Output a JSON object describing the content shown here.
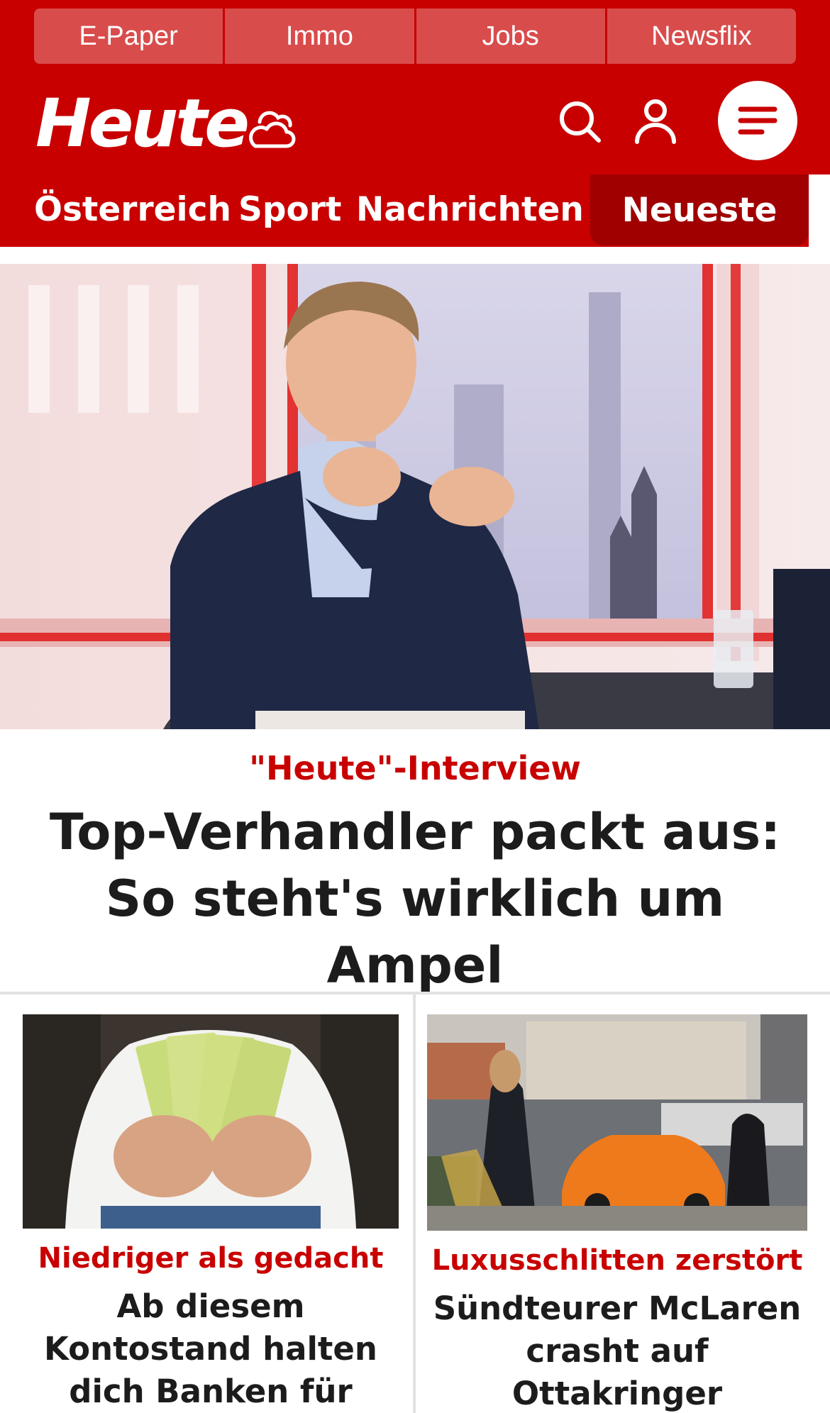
{
  "top_links": [
    "E-Paper",
    "Immo",
    "Jobs",
    "Newsflix"
  ],
  "brand": {
    "logo": "Heute"
  },
  "icons": {
    "weather": "weather-cloud-icon",
    "search": "search-icon",
    "user": "user-icon",
    "menu": "menu-icon"
  },
  "nav": {
    "items": [
      "Österreich",
      "Sport",
      "Nachrichten"
    ],
    "active": "Neueste"
  },
  "hero": {
    "kicker": "\"Heute\"-Interview",
    "headline": "Top-Verhandler packt aus: So steht's wirklich um Ampel"
  },
  "cards": [
    {
      "kicker": "Niedriger als gedacht",
      "headline": "Ab diesem Kontostand halten dich Banken für \"reich\""
    },
    {
      "kicker": "Luxusschlitten zerstört",
      "headline": "Sündteurer McLaren crasht auf Ottakringer \"Balkanmeile\""
    }
  ],
  "colors": {
    "brand_red": "#c80000",
    "active_tab": "#a00000",
    "top_link_bg": "#d94c4c"
  }
}
